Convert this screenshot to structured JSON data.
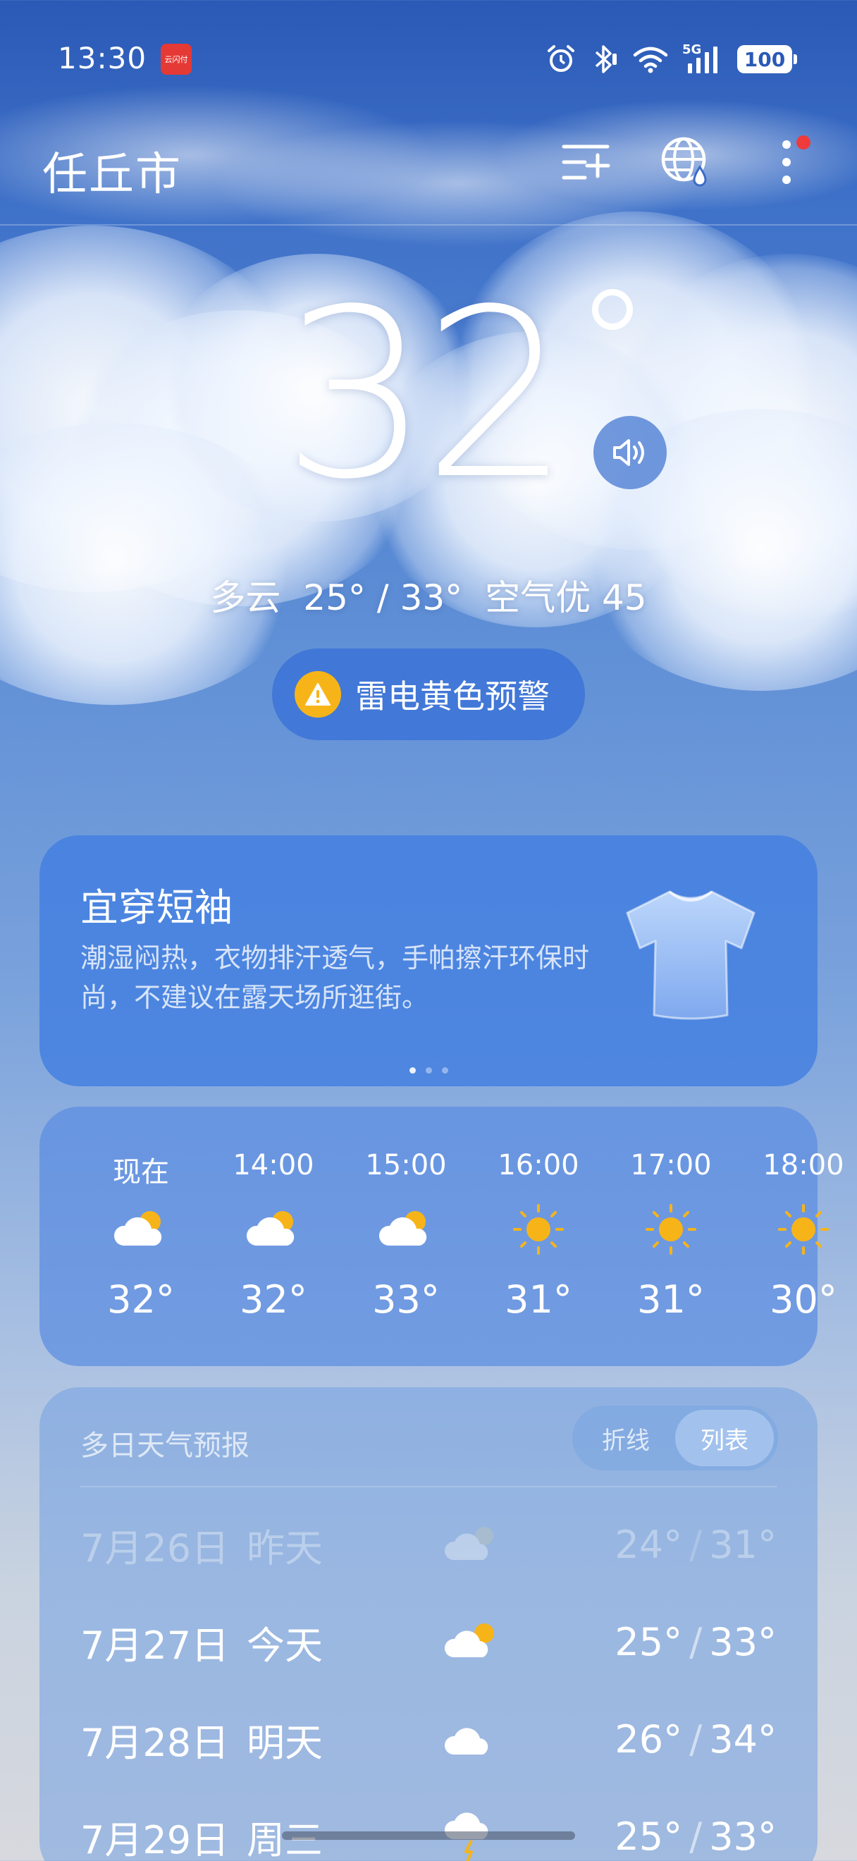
{
  "status_bar": {
    "time": "13:30",
    "app_icon_text": "云闪付",
    "network": "5G",
    "battery": "100"
  },
  "header": {
    "city": "任丘市",
    "icons": [
      "add-city-list-icon",
      "globe-weather-icon",
      "more-vertical-icon"
    ]
  },
  "current": {
    "temperature": "32",
    "condition": "多云",
    "low": "25°",
    "slash": "/",
    "high": "33°",
    "aqi_label": "空气优",
    "aqi_value": "45"
  },
  "alert": {
    "text": "雷电黄色预警",
    "color": "#f7b419"
  },
  "tip_card": {
    "title": "宜穿短袖",
    "description": "潮湿闷热，衣物排汗透气，手帕擦汗环保时尚，不建议在露天场所逛街。"
  },
  "hourly": [
    {
      "label": "现在",
      "icon": "partly-cloudy-icon",
      "temp": "32°"
    },
    {
      "label": "14:00",
      "icon": "partly-cloudy-icon",
      "temp": "32°"
    },
    {
      "label": "15:00",
      "icon": "partly-cloudy-icon",
      "temp": "33°"
    },
    {
      "label": "16:00",
      "icon": "sunny-icon",
      "temp": "31°"
    },
    {
      "label": "17:00",
      "icon": "sunny-icon",
      "temp": "31°"
    },
    {
      "label": "18:00",
      "icon": "sunny-icon",
      "temp": "30°"
    }
  ],
  "daily": {
    "title": "多日天气预报",
    "toggle": [
      "折线",
      "列表"
    ],
    "selected_toggle": "列表",
    "days": [
      {
        "date": "7月26日",
        "name": "昨天",
        "icon": "cloudy-icon",
        "low": "24°",
        "high": "31°"
      },
      {
        "date": "7月27日",
        "name": "今天",
        "icon": "partly-cloudy-icon",
        "low": "25°",
        "high": "33°"
      },
      {
        "date": "7月28日",
        "name": "明天",
        "icon": "cloudy-icon",
        "low": "26°",
        "high": "34°"
      },
      {
        "date": "7月29日",
        "name": "周三",
        "icon": "thunderstorm-icon",
        "low": "25°",
        "high": "33°"
      }
    ]
  },
  "colors": {
    "sun": "#f7b419",
    "notification_dot": "#ef3b3b"
  }
}
